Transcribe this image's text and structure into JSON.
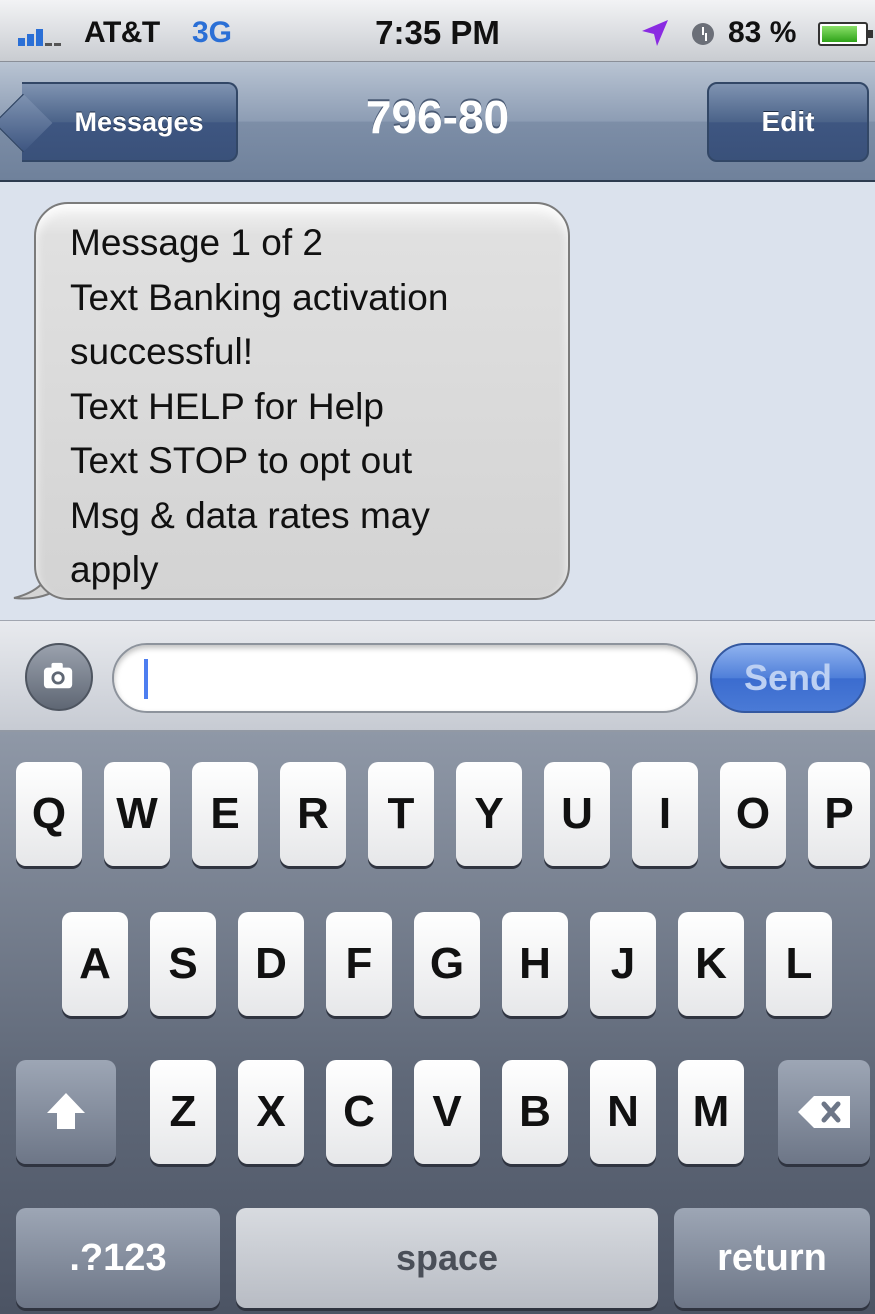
{
  "status_bar": {
    "carrier": "AT&T",
    "network": "3G",
    "time": "7:35 PM",
    "battery": "83 %",
    "battery_level": 0.83,
    "icons": [
      "signal-icon",
      "location-arrow-icon",
      "alarm-clock-icon",
      "battery-icon"
    ]
  },
  "nav": {
    "back_label": "Messages",
    "title": "796-80",
    "edit_label": "Edit"
  },
  "conversation": {
    "messages": [
      {
        "lines": [
          "Message 1 of 2",
          "Text Banking activation",
          "successful!",
          "Text HELP for Help",
          "Text STOP to opt out",
          "Msg & data rates may",
          "apply"
        ]
      }
    ]
  },
  "compose": {
    "value": "",
    "send_label": "Send"
  },
  "keyboard": {
    "row1": [
      "Q",
      "W",
      "E",
      "R",
      "T",
      "Y",
      "U",
      "I",
      "O",
      "P"
    ],
    "row2": [
      "A",
      "S",
      "D",
      "F",
      "G",
      "H",
      "J",
      "K",
      "L"
    ],
    "row3": [
      "Z",
      "X",
      "C",
      "V",
      "B",
      "N",
      "M"
    ],
    "numbers_label": ".?123",
    "space_label": "space",
    "return_label": "return"
  },
  "colors": {
    "accent": "#2a6fd6",
    "nav_bar": "#7d8ea7",
    "bubble": "#d3d3d3",
    "background": "#dbe2ed"
  }
}
